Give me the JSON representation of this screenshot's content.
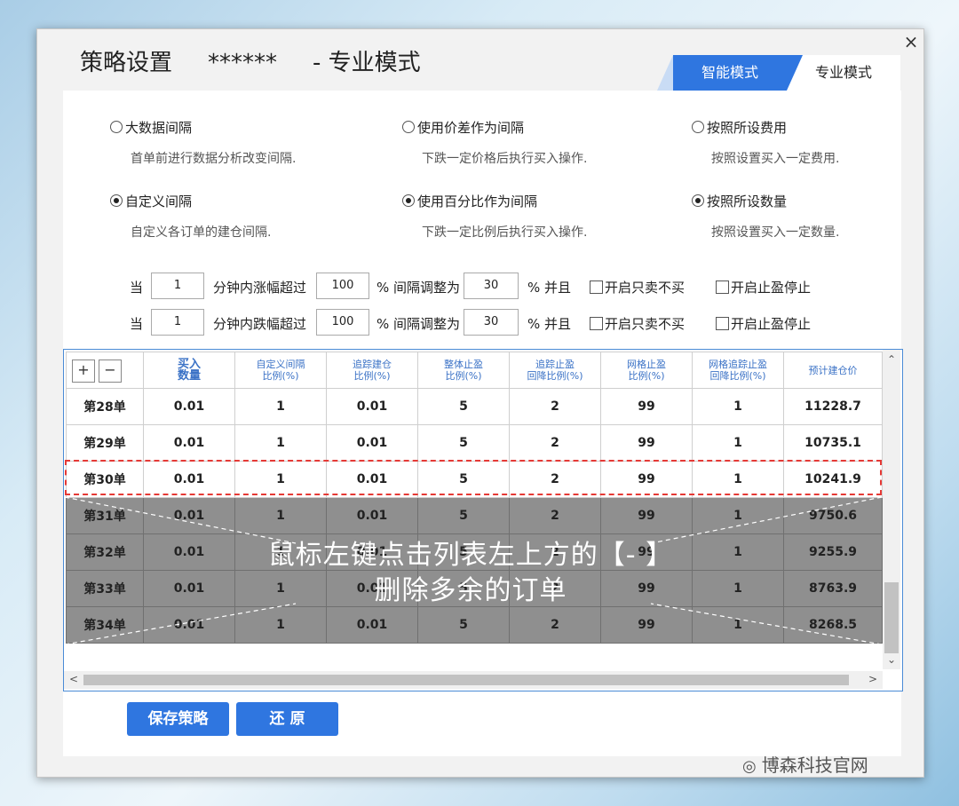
{
  "window": {
    "title": "策略设置",
    "masked": "******",
    "mode_suffix": "- 专业模式",
    "close_glyph": "×"
  },
  "tabs": {
    "smart": "智能模式",
    "pro": "专业模式"
  },
  "options": [
    {
      "label": "大数据间隔",
      "desc": "首单前进行数据分析改变间隔.",
      "checked": false
    },
    {
      "label": "使用价差作为间隔",
      "desc": "下跌一定价格后执行买入操作.",
      "checked": false
    },
    {
      "label": "按照所设费用",
      "desc": "按照设置买入一定费用.",
      "checked": false
    },
    {
      "label": "自定义间隔",
      "desc": "自定义各订单的建仓间隔.",
      "checked": true
    },
    {
      "label": "使用百分比作为间隔",
      "desc": "下跌一定比例后执行买入操作.",
      "checked": true
    },
    {
      "label": "按照所设数量",
      "desc": "按照设置买入一定数量.",
      "checked": true
    }
  ],
  "rules": [
    {
      "w1": "当",
      "minutes": "1",
      "w2": "分钟内涨幅超过",
      "pct": "100",
      "w3": "% 间隔调整为",
      "adj": "30",
      "w4": "% 并且",
      "c1": "开启只卖不买",
      "c2": "开启止盈停止"
    },
    {
      "w1": "当",
      "minutes": "1",
      "w2": "分钟内跌幅超过",
      "pct": "100",
      "w3": "% 间隔调整为",
      "adj": "30",
      "w4": "% 并且",
      "c1": "开启只卖不买",
      "c2": "开启止盈停止"
    }
  ],
  "table": {
    "add": "+",
    "remove": "−",
    "headers": [
      [
        "买入",
        "数量"
      ],
      [
        "自定义间隔",
        "比例(%)"
      ],
      [
        "追踪建仓",
        "比例(%)"
      ],
      [
        "整体止盈",
        "比例(%)"
      ],
      [
        "追踪止盈",
        "回降比例(%)"
      ],
      [
        "网格止盈",
        "比例(%)"
      ],
      [
        "网格追踪止盈",
        "回降比例(%)"
      ],
      [
        "预计建仓价",
        ""
      ]
    ],
    "rows": [
      [
        "第28单",
        "0.01",
        "1",
        "0.01",
        "5",
        "2",
        "99",
        "1",
        "11228.7"
      ],
      [
        "第29单",
        "0.01",
        "1",
        "0.01",
        "5",
        "2",
        "99",
        "1",
        "10735.1"
      ],
      [
        "第30单",
        "0.01",
        "1",
        "0.01",
        "5",
        "2",
        "99",
        "1",
        "10241.9"
      ],
      [
        "第31单",
        "0.01",
        "1",
        "0.01",
        "5",
        "2",
        "99",
        "1",
        "9750.6"
      ],
      [
        "第32单",
        "0.01",
        "1",
        "0.01",
        "5",
        "2",
        "99",
        "1",
        "9255.9"
      ],
      [
        "第33单",
        "0.01",
        "1",
        "0.01",
        "5",
        "2",
        "99",
        "1",
        "8763.9"
      ],
      [
        "第34单",
        "0.01",
        "1",
        "0.01",
        "5",
        "2",
        "99",
        "1",
        "8268.5"
      ]
    ]
  },
  "overlay": {
    "line1": "鼠标左键点击列表左上方的【- 】",
    "line2": "删除多余的订单"
  },
  "buttons": {
    "save": "保存策略",
    "restore": "还 原"
  },
  "watermark": "博森科技官网"
}
